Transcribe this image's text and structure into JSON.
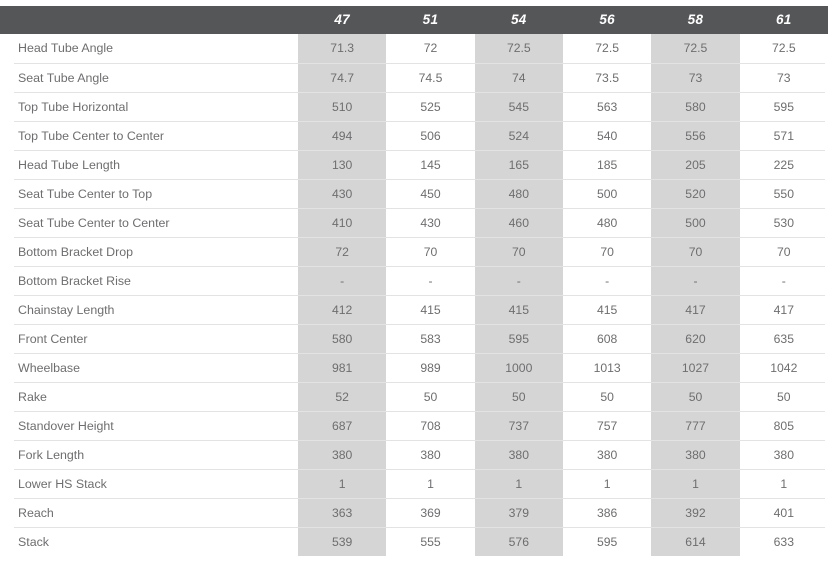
{
  "table": {
    "label_column_header": "",
    "size_headers": [
      "47",
      "51",
      "54",
      "56",
      "58",
      "61"
    ],
    "shaded_column_indices": [
      0,
      2,
      4
    ],
    "colors": {
      "header_background": "#555658",
      "header_text": "#ffffff",
      "shaded_cell": "#d5d5d5",
      "plain_cell": "#ffffff",
      "body_text": "#6e6e70",
      "row_divider": "#e3e3e3"
    },
    "rows": [
      {
        "label": "Head Tube Angle",
        "values": [
          "71.3",
          "72",
          "72.5",
          "72.5",
          "72.5",
          "72.5"
        ]
      },
      {
        "label": "Seat Tube Angle",
        "values": [
          "74.7",
          "74.5",
          "74",
          "73.5",
          "73",
          "73"
        ]
      },
      {
        "label": "Top Tube Horizontal",
        "values": [
          "510",
          "525",
          "545",
          "563",
          "580",
          "595"
        ]
      },
      {
        "label": "Top Tube Center to Center",
        "values": [
          "494",
          "506",
          "524",
          "540",
          "556",
          "571"
        ]
      },
      {
        "label": "Head Tube Length",
        "values": [
          "130",
          "145",
          "165",
          "185",
          "205",
          "225"
        ]
      },
      {
        "label": "Seat Tube Center to Top",
        "values": [
          "430",
          "450",
          "480",
          "500",
          "520",
          "550"
        ]
      },
      {
        "label": "Seat Tube Center to Center",
        "values": [
          "410",
          "430",
          "460",
          "480",
          "500",
          "530"
        ]
      },
      {
        "label": "Bottom Bracket Drop",
        "values": [
          "72",
          "70",
          "70",
          "70",
          "70",
          "70"
        ]
      },
      {
        "label": "Bottom Bracket Rise",
        "values": [
          "-",
          "-",
          "-",
          "-",
          "-",
          "-"
        ]
      },
      {
        "label": "Chainstay Length",
        "values": [
          "412",
          "415",
          "415",
          "415",
          "417",
          "417"
        ]
      },
      {
        "label": "Front Center",
        "values": [
          "580",
          "583",
          "595",
          "608",
          "620",
          "635"
        ]
      },
      {
        "label": "Wheelbase",
        "values": [
          "981",
          "989",
          "1000",
          "1013",
          "1027",
          "1042"
        ]
      },
      {
        "label": "Rake",
        "values": [
          "52",
          "50",
          "50",
          "50",
          "50",
          "50"
        ]
      },
      {
        "label": "Standover Height",
        "values": [
          "687",
          "708",
          "737",
          "757",
          "777",
          "805"
        ]
      },
      {
        "label": "Fork Length",
        "values": [
          "380",
          "380",
          "380",
          "380",
          "380",
          "380"
        ]
      },
      {
        "label": "Lower HS Stack",
        "values": [
          "1",
          "1",
          "1",
          "1",
          "1",
          "1"
        ]
      },
      {
        "label": "Reach",
        "values": [
          "363",
          "369",
          "379",
          "386",
          "392",
          "401"
        ]
      },
      {
        "label": "Stack",
        "values": [
          "539",
          "555",
          "576",
          "595",
          "614",
          "633"
        ]
      }
    ]
  }
}
